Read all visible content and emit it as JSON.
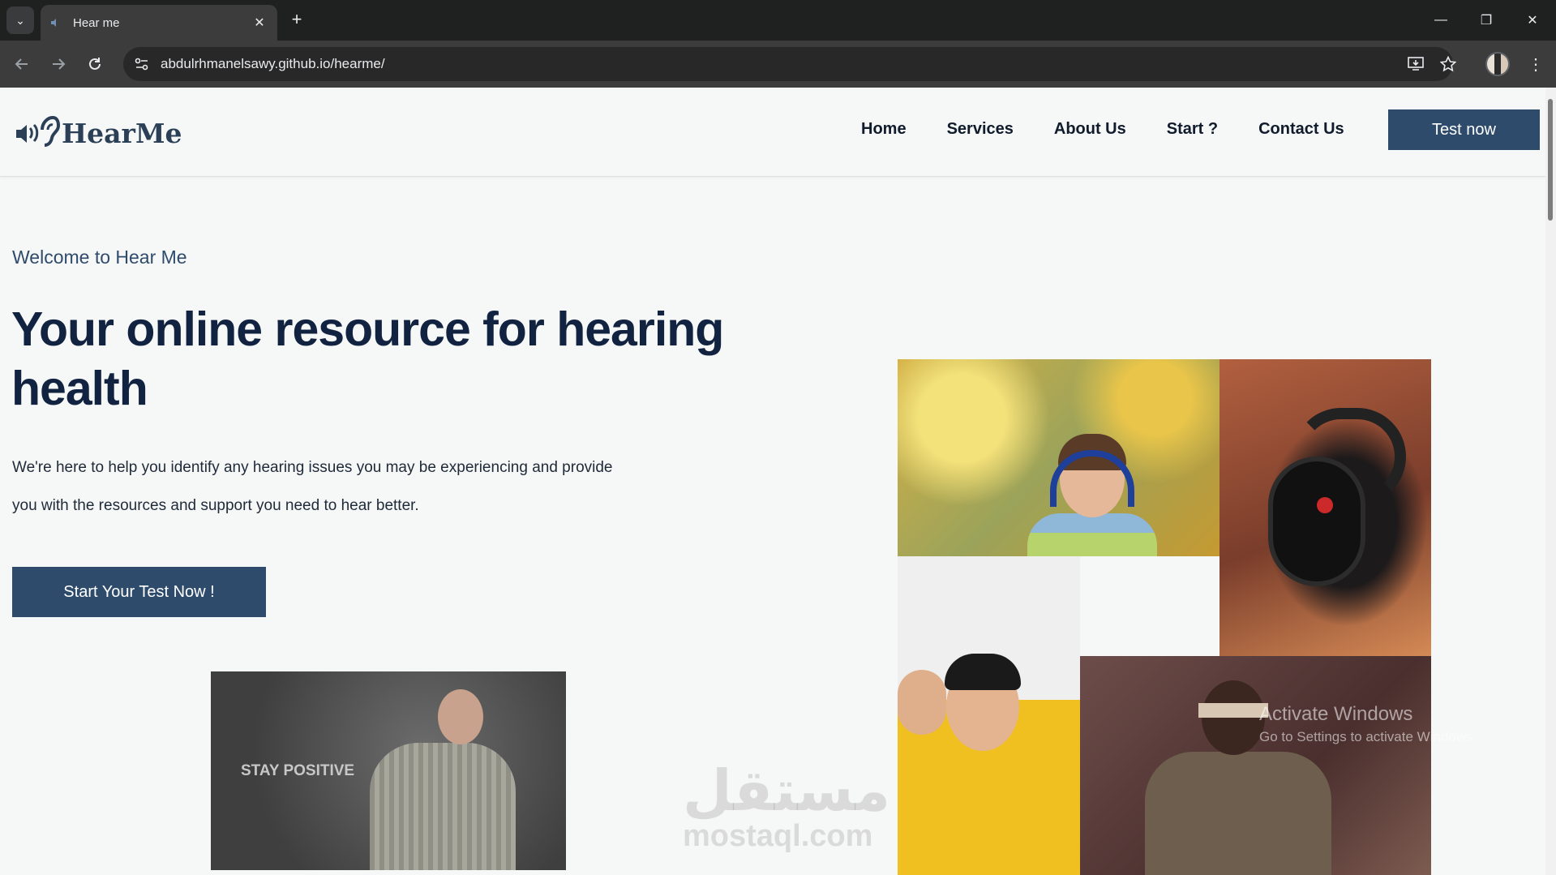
{
  "browser": {
    "tab_title": "Hear me",
    "url": "abdulrhmanelsawy.github.io/hearme/"
  },
  "header": {
    "logo_text": "HearMe",
    "nav": [
      "Home",
      "Services",
      "About Us",
      "Start ?",
      "Contact Us"
    ],
    "test_now_label": "Test now"
  },
  "hero": {
    "welcome": "Welcome to Hear Me",
    "title": "Your online resource for hearing health",
    "description_line1": "We're here to help you identify any hearing issues you may be experiencing and provide",
    "description_line2": "you with the resources and support you need to hear better.",
    "cta_label": "Start Your Test Now !"
  },
  "video": {
    "caption": "STAY POSITIVE"
  },
  "watermark": {
    "arabic": "مستقل",
    "latin": "mostaql.com"
  },
  "os_overlay": {
    "title": "Activate Windows",
    "subtitle": "Go to Settings to activate Windows."
  },
  "colors": {
    "primary": "#2f4b6b",
    "heading": "#112340",
    "background": "#f6f7f7"
  }
}
